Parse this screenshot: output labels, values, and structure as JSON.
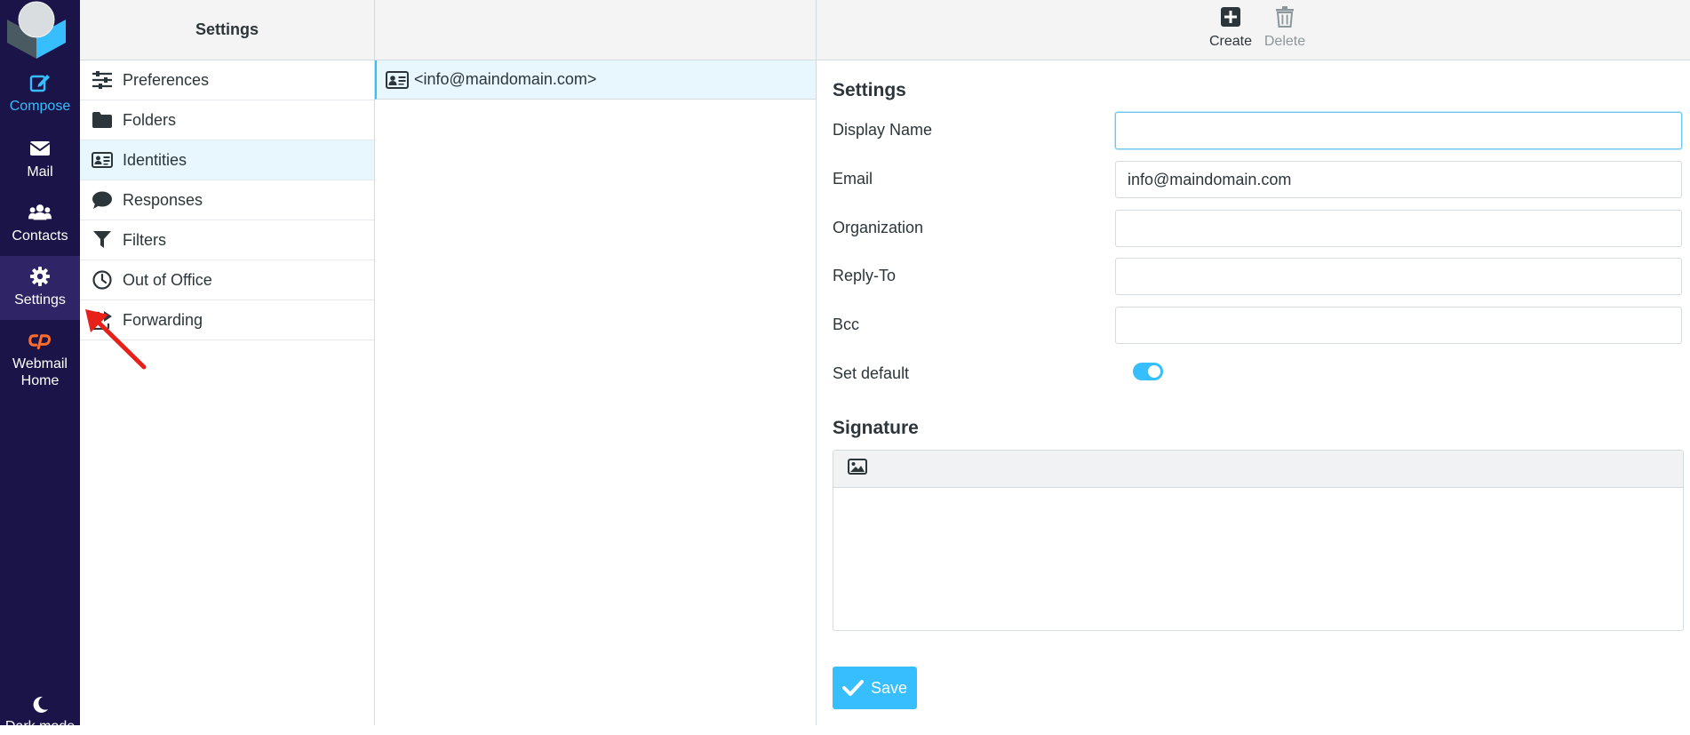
{
  "nav": {
    "compose": "Compose",
    "mail": "Mail",
    "contacts": "Contacts",
    "settings": "Settings",
    "webmail_home_line1": "Webmail",
    "webmail_home_line2": "Home",
    "dark_mode": "Dark mode"
  },
  "settings_list": {
    "title": "Settings",
    "items": [
      {
        "label": "Preferences",
        "icon": "sliders-icon"
      },
      {
        "label": "Folders",
        "icon": "folder-icon"
      },
      {
        "label": "Identities",
        "icon": "id-card-icon",
        "selected": true
      },
      {
        "label": "Responses",
        "icon": "comment-icon"
      },
      {
        "label": "Filters",
        "icon": "filter-icon"
      },
      {
        "label": "Out of Office",
        "icon": "clock-icon"
      },
      {
        "label": "Forwarding",
        "icon": "share-icon"
      }
    ]
  },
  "identities": {
    "items": [
      {
        "label": "<info@maindomain.com>"
      }
    ]
  },
  "toolbar": {
    "create": "Create",
    "delete": "Delete"
  },
  "form": {
    "settings_heading": "Settings",
    "display_name_label": "Display Name",
    "display_name_value": "",
    "email_label": "Email",
    "email_value": "info@maindomain.com",
    "organization_label": "Organization",
    "organization_value": "",
    "reply_to_label": "Reply-To",
    "reply_to_value": "",
    "bcc_label": "Bcc",
    "bcc_value": "",
    "set_default_label": "Set default",
    "set_default_on": true,
    "signature_heading": "Signature",
    "save_label": "Save"
  },
  "colors": {
    "nav_bg": "#1b1448",
    "accent": "#37beff",
    "cpanel_orange": "#ff6c2c",
    "selected_bg": "#e8f7fd"
  }
}
